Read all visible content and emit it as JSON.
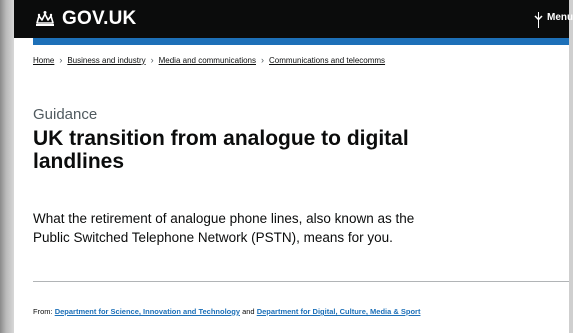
{
  "header": {
    "logo_text": "GOV.UK",
    "menu_label": "Menu",
    "logo_icon": "crown-icon",
    "menu_icon": "chevron-down-icon",
    "background": "#0b0c0c",
    "accent": "#1d70b8"
  },
  "breadcrumbs": [
    "Home",
    "Business and industry",
    "Media and communications",
    "Communications and telecomms"
  ],
  "page": {
    "caption": "Guidance",
    "title": "UK transition from analogue to digital landlines",
    "lede": "What the retirement of analogue phone lines, also known as the Public Switched Telephone Network (PSTN), means for you."
  },
  "from": {
    "prefix": "From:",
    "org1": "Department for Science, Innovation and Technology",
    "conj": "and",
    "org2": "Department for Digital, Culture, Media & Sport"
  }
}
